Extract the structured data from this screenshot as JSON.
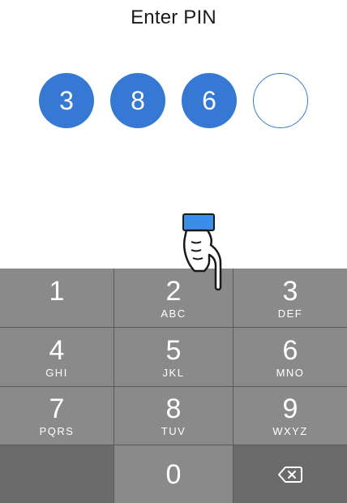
{
  "header": {
    "title": "Enter PIN"
  },
  "pin": {
    "digits": [
      "3",
      "8",
      "6",
      ""
    ],
    "accent_color": "#3579d4"
  },
  "keypad": {
    "keys": [
      {
        "digit": "1",
        "letters": ""
      },
      {
        "digit": "2",
        "letters": "ABC"
      },
      {
        "digit": "3",
        "letters": "DEF"
      },
      {
        "digit": "4",
        "letters": "GHI"
      },
      {
        "digit": "5",
        "letters": "JKL"
      },
      {
        "digit": "6",
        "letters": "MNO"
      },
      {
        "digit": "7",
        "letters": "PQRS"
      },
      {
        "digit": "8",
        "letters": "TUV"
      },
      {
        "digit": "9",
        "letters": "WXYZ"
      },
      {
        "digit": "0",
        "letters": ""
      }
    ],
    "delete_icon": "backspace-icon"
  },
  "overlay": {
    "pointer_icon": "hand-pointer-icon"
  }
}
